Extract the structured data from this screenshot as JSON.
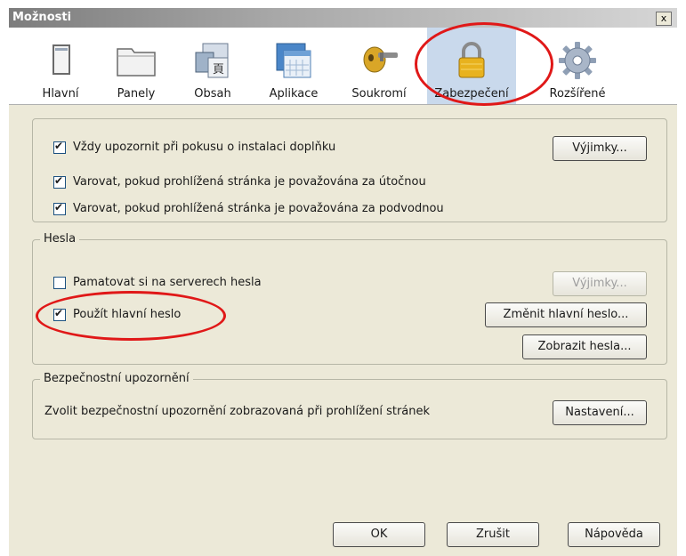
{
  "window": {
    "title": "Možnosti",
    "close_label": "x"
  },
  "toolbar": {
    "tabs": [
      {
        "label": "Hlavní",
        "icon": "main-window-icon"
      },
      {
        "label": "Panely",
        "icon": "tabs-folder-icon"
      },
      {
        "label": "Obsah",
        "icon": "content-icon"
      },
      {
        "label": "Aplikace",
        "icon": "applications-icon"
      },
      {
        "label": "Soukromí",
        "icon": "privacy-mask-icon"
      },
      {
        "label": "Zabezpečení",
        "icon": "padlock-icon",
        "selected": true
      },
      {
        "label": "Rozšířené",
        "icon": "gear-icon"
      }
    ]
  },
  "general": {
    "warn_addons_label": "Vždy upozornit při pokusu o instalaci doplňku",
    "warn_addons_checked": true,
    "exceptions_button": "Výjimky...",
    "warn_attack_label": "Varovat, pokud prohlížená stránka je považována za útočnou",
    "warn_attack_checked": true,
    "warn_forgery_label": "Varovat, pokud prohlížená stránka je považována za podvodnou",
    "warn_forgery_checked": true
  },
  "passwords": {
    "legend": "Hesla",
    "remember_label": "Pamatovat si na serverech hesla",
    "remember_checked": false,
    "exceptions_button": "Výjimky...",
    "master_label": "Použít hlavní heslo",
    "master_checked": true,
    "change_master_button": "Změnit hlavní heslo...",
    "show_passwords_button": "Zobrazit hesla..."
  },
  "warnings": {
    "legend": "Bezpečnostní upozornění",
    "description": "Zvolit bezpečnostní upozornění zobrazovaná při prohlížení stránek",
    "settings_button": "Nastavení..."
  },
  "footer": {
    "ok": "OK",
    "cancel": "Zrušit",
    "help": "Nápověda"
  },
  "colors": {
    "highlight_ellipse": "#e01818",
    "selected_tab": "#c9d9ec"
  }
}
